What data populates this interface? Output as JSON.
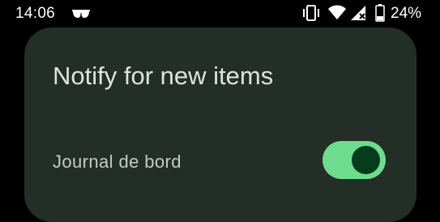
{
  "status_bar": {
    "time": "14:06",
    "battery": "24%",
    "icons": [
      "glasses-icon",
      "vibrate-icon",
      "wifi-icon",
      "signal-icon",
      "battery-icon"
    ]
  },
  "dialog": {
    "title": "Notify for new items",
    "items": [
      {
        "label": "Journal de bord",
        "enabled": true
      }
    ]
  },
  "colors": {
    "background": "#000000",
    "dialog_surface": "#232e27",
    "toggle_track_on": "#6fdb8e",
    "toggle_thumb_on": "#053d1c",
    "title_text": "#dde4dd",
    "label_text": "#c3cbc4"
  }
}
